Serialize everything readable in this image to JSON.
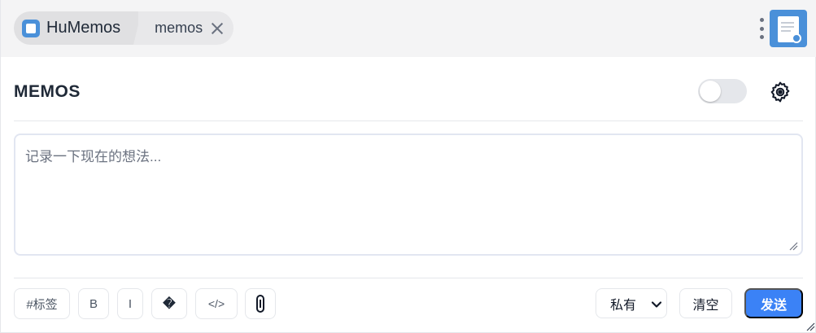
{
  "breadcrumb": {
    "home_label": "HuMemos",
    "tab_label": "memos"
  },
  "header": {
    "title": "MEMOS",
    "toggle_on": false
  },
  "editor": {
    "placeholder": "记录一下现在的想法...",
    "value": ""
  },
  "toolbar": {
    "tag_label": "#标签",
    "bold_label": "B",
    "italic_label": "I",
    "emoji_label": "�",
    "code_label": "</>",
    "visibility": {
      "selected": "私有"
    },
    "clear_label": "清空",
    "send_label": "发送"
  },
  "icons": {
    "app": "memo-app-icon",
    "close": "close-icon",
    "more": "more-vertical-icon",
    "plugin": "document-plugin-icon",
    "settings": "gear-icon",
    "attachment": "paperclip-icon",
    "dropdown": "chevron-down-icon"
  },
  "colors": {
    "accent": "#3b82f6",
    "app_icon": "#4a90d9",
    "topbar_bg": "#f4f4f5"
  }
}
